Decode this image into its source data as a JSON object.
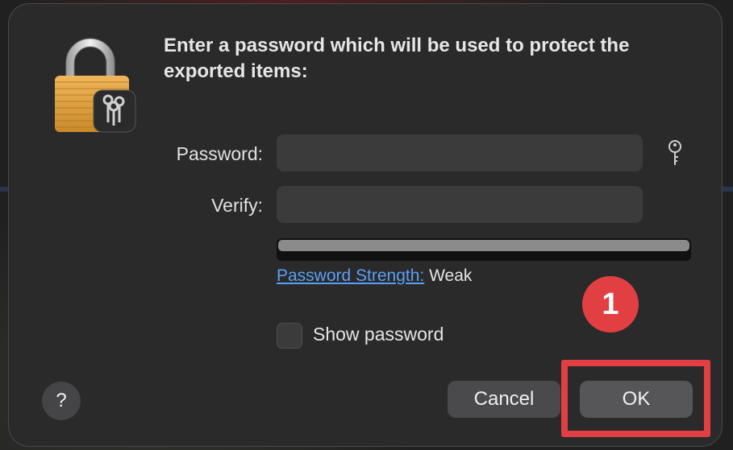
{
  "dialog": {
    "title": "Enter a password which will be used to protect the exported items:",
    "password_label": "Password:",
    "password_value": "",
    "verify_label": "Verify:",
    "verify_value": "",
    "password_strength_link": "Password Strength:",
    "password_strength_value": "Weak",
    "password_strength_level": 0.0,
    "show_password_label": "Show password",
    "show_password_checked": false,
    "help_label": "?",
    "cancel_label": "Cancel",
    "ok_label": "OK"
  },
  "annotation": {
    "step_number": "1",
    "color": "#e23f43"
  },
  "icons": {
    "lock": "keychain-lock-icon",
    "key": "password-assistant-key-icon"
  }
}
